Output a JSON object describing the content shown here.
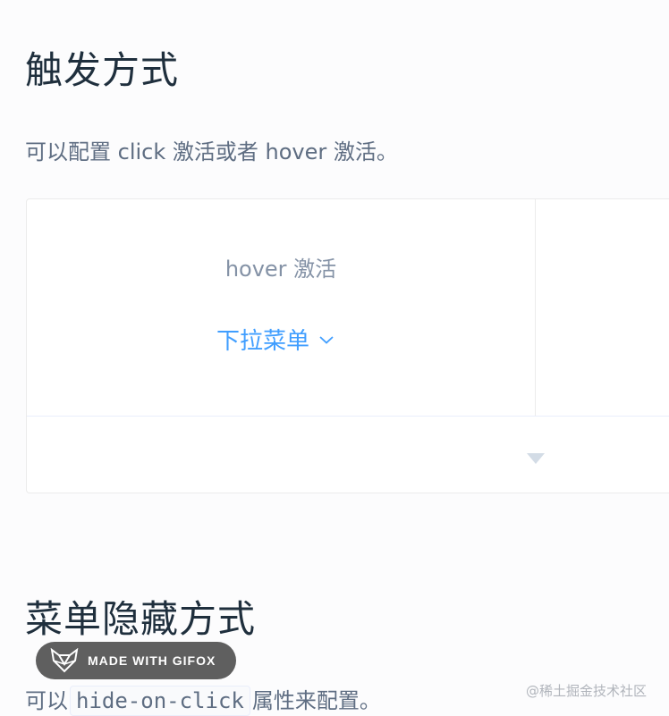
{
  "section1": {
    "title": "触发方式",
    "description": "可以配置 click 激活或者 hover 激活。"
  },
  "demo": {
    "subtitle": "hover 激活",
    "dropdown_label": "下拉菜单"
  },
  "section2": {
    "title": "菜单隐藏方式",
    "desc_prefix": "可以",
    "code": "hide-on-click",
    "desc_suffix": "属性来配置。"
  },
  "overlay": {
    "gifox_label": "MADE WITH GIFOX",
    "watermark": "@稀土掘金技术社区"
  },
  "colors": {
    "link": "#409eff",
    "text": "#5e6d82",
    "heading": "#1f2f3d"
  }
}
